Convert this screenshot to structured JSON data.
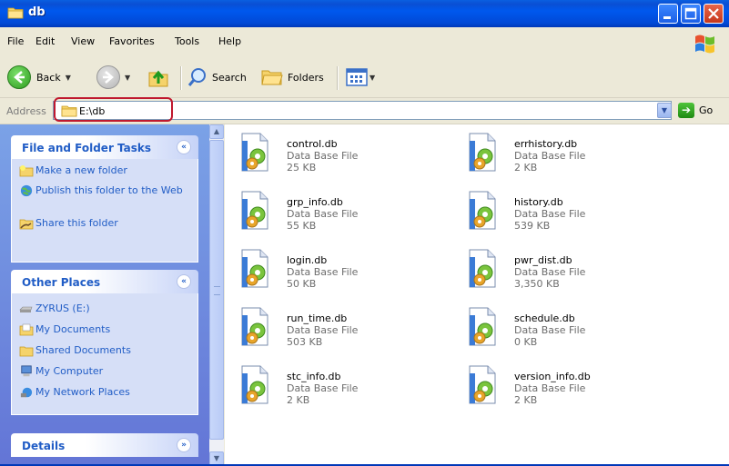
{
  "window": {
    "title": "db"
  },
  "menu": [
    {
      "label": "File",
      "key": "F"
    },
    {
      "label": "Edit",
      "key": "E"
    },
    {
      "label": "View",
      "key": "V"
    },
    {
      "label": "Favorites",
      "key": "a"
    },
    {
      "label": "Tools",
      "key": "T"
    },
    {
      "label": "Help",
      "key": "H"
    }
  ],
  "toolbar": {
    "back": "Back",
    "search": "Search",
    "folders": "Folders"
  },
  "address": {
    "label": "Address",
    "path": "E:\\db",
    "go": "Go"
  },
  "left": {
    "tasks": {
      "title": "File and Folder Tasks",
      "links": [
        "Make a new folder",
        "Publish this folder to the Web",
        "Share this folder"
      ]
    },
    "places": {
      "title": "Other Places",
      "links": [
        "ZYRUS (E:)",
        "My Documents",
        "Shared Documents",
        "My Computer",
        "My Network Places"
      ]
    },
    "details": {
      "title": "Details"
    }
  },
  "files": [
    {
      "name": "control.db",
      "type": "Data Base File",
      "size": "25 KB"
    },
    {
      "name": "errhistory.db",
      "type": "Data Base File",
      "size": "2 KB"
    },
    {
      "name": "grp_info.db",
      "type": "Data Base File",
      "size": "55 KB"
    },
    {
      "name": "history.db",
      "type": "Data Base File",
      "size": "539 KB"
    },
    {
      "name": "login.db",
      "type": "Data Base File",
      "size": "50 KB"
    },
    {
      "name": "pwr_dist.db",
      "type": "Data Base File",
      "size": "3,350 KB"
    },
    {
      "name": "run_time.db",
      "type": "Data Base File",
      "size": "503 KB"
    },
    {
      "name": "schedule.db",
      "type": "Data Base File",
      "size": "0 KB"
    },
    {
      "name": "stc_info.db",
      "type": "Data Base File",
      "size": "2 KB"
    },
    {
      "name": "version_info.db",
      "type": "Data Base File",
      "size": "2 KB"
    }
  ],
  "colors": {
    "titlebar": "#0058ee",
    "panel_link": "#215dc6",
    "highlight": "#c0182e"
  }
}
